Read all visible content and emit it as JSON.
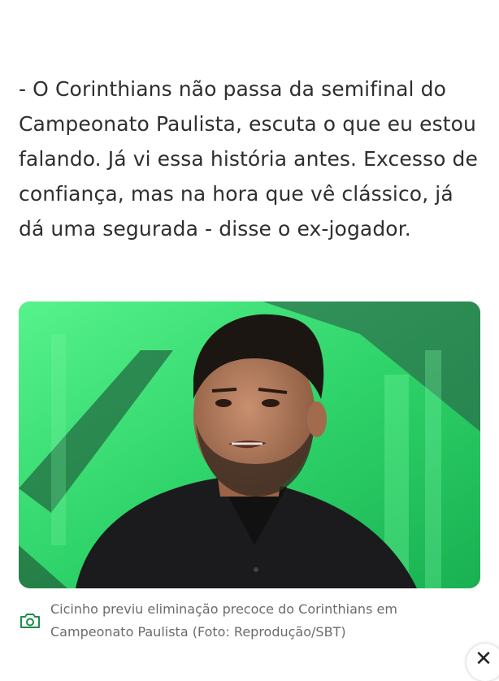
{
  "article": {
    "paragraph": "- O Corinthians não passa da semifinal do Campeonato Paulista, escuta o que eu estou falando. Já vi essa história antes. Excesso de confiança, mas na hora que vê clássico, já dá uma segurada - disse o ex-jogador."
  },
  "figure": {
    "caption": "Cicinho previu eliminação precoce do Corinthians em Campeonato Paulista (Foto: Reprodução/SBT)"
  },
  "icons": {
    "caption_icon": "camera-icon",
    "close_icon": "close-icon"
  },
  "close_button": {
    "label": "✕"
  },
  "colors": {
    "accent": "#1a8f4a",
    "studio_green": "#3fe07a",
    "caption_text": "#6b6b6b"
  }
}
